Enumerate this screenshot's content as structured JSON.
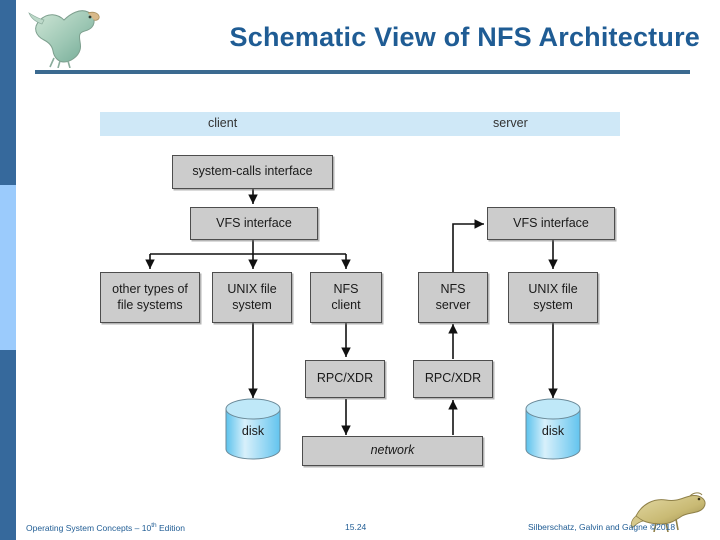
{
  "slide": {
    "title": "Schematic View of NFS Architecture",
    "accent_color": "#1f5c94",
    "rule_color": "#3b6a90",
    "strip_dark_color": "#36699c",
    "strip_light_color": "#9bcbfc"
  },
  "diagram": {
    "headers": [
      {
        "label": "client"
      },
      {
        "label": "server"
      }
    ],
    "boxes": [
      {
        "id": "system-calls-interface",
        "label": "system-calls interface"
      },
      {
        "id": "vfs-interface-client",
        "label": "VFS interface"
      },
      {
        "id": "other-types-of-file-systems",
        "label": "other types of\nfile systems"
      },
      {
        "id": "unix-file-system-client",
        "label": "UNIX file\nsystem"
      },
      {
        "id": "nfs-client",
        "label": "NFS\nclient"
      },
      {
        "id": "nfs-server",
        "label": "NFS\nserver"
      },
      {
        "id": "unix-file-system-server",
        "label": "UNIX file\nsystem"
      },
      {
        "id": "vfs-interface-server",
        "label": "VFS interface"
      },
      {
        "id": "rpc-xdr-client",
        "label": "RPC/XDR"
      },
      {
        "id": "rpc-xdr-server",
        "label": "RPC/XDR"
      },
      {
        "id": "network",
        "label": "network"
      }
    ],
    "disks": [
      {
        "id": "disk-client",
        "label": "disk"
      },
      {
        "id": "disk-server",
        "label": "disk"
      }
    ],
    "box_fill": "#cccccc",
    "box_border": "#4d4d4d",
    "header_fill": "#cfe8f7",
    "disk_fill": "#8ed2f0"
  },
  "footer": {
    "left_prefix": "Operating System Concepts – 10",
    "left_sup": "th",
    "left_suffix": " Edition",
    "center": "15.24",
    "right": "Silberschatz, Galvin and Gagne ©2018"
  }
}
